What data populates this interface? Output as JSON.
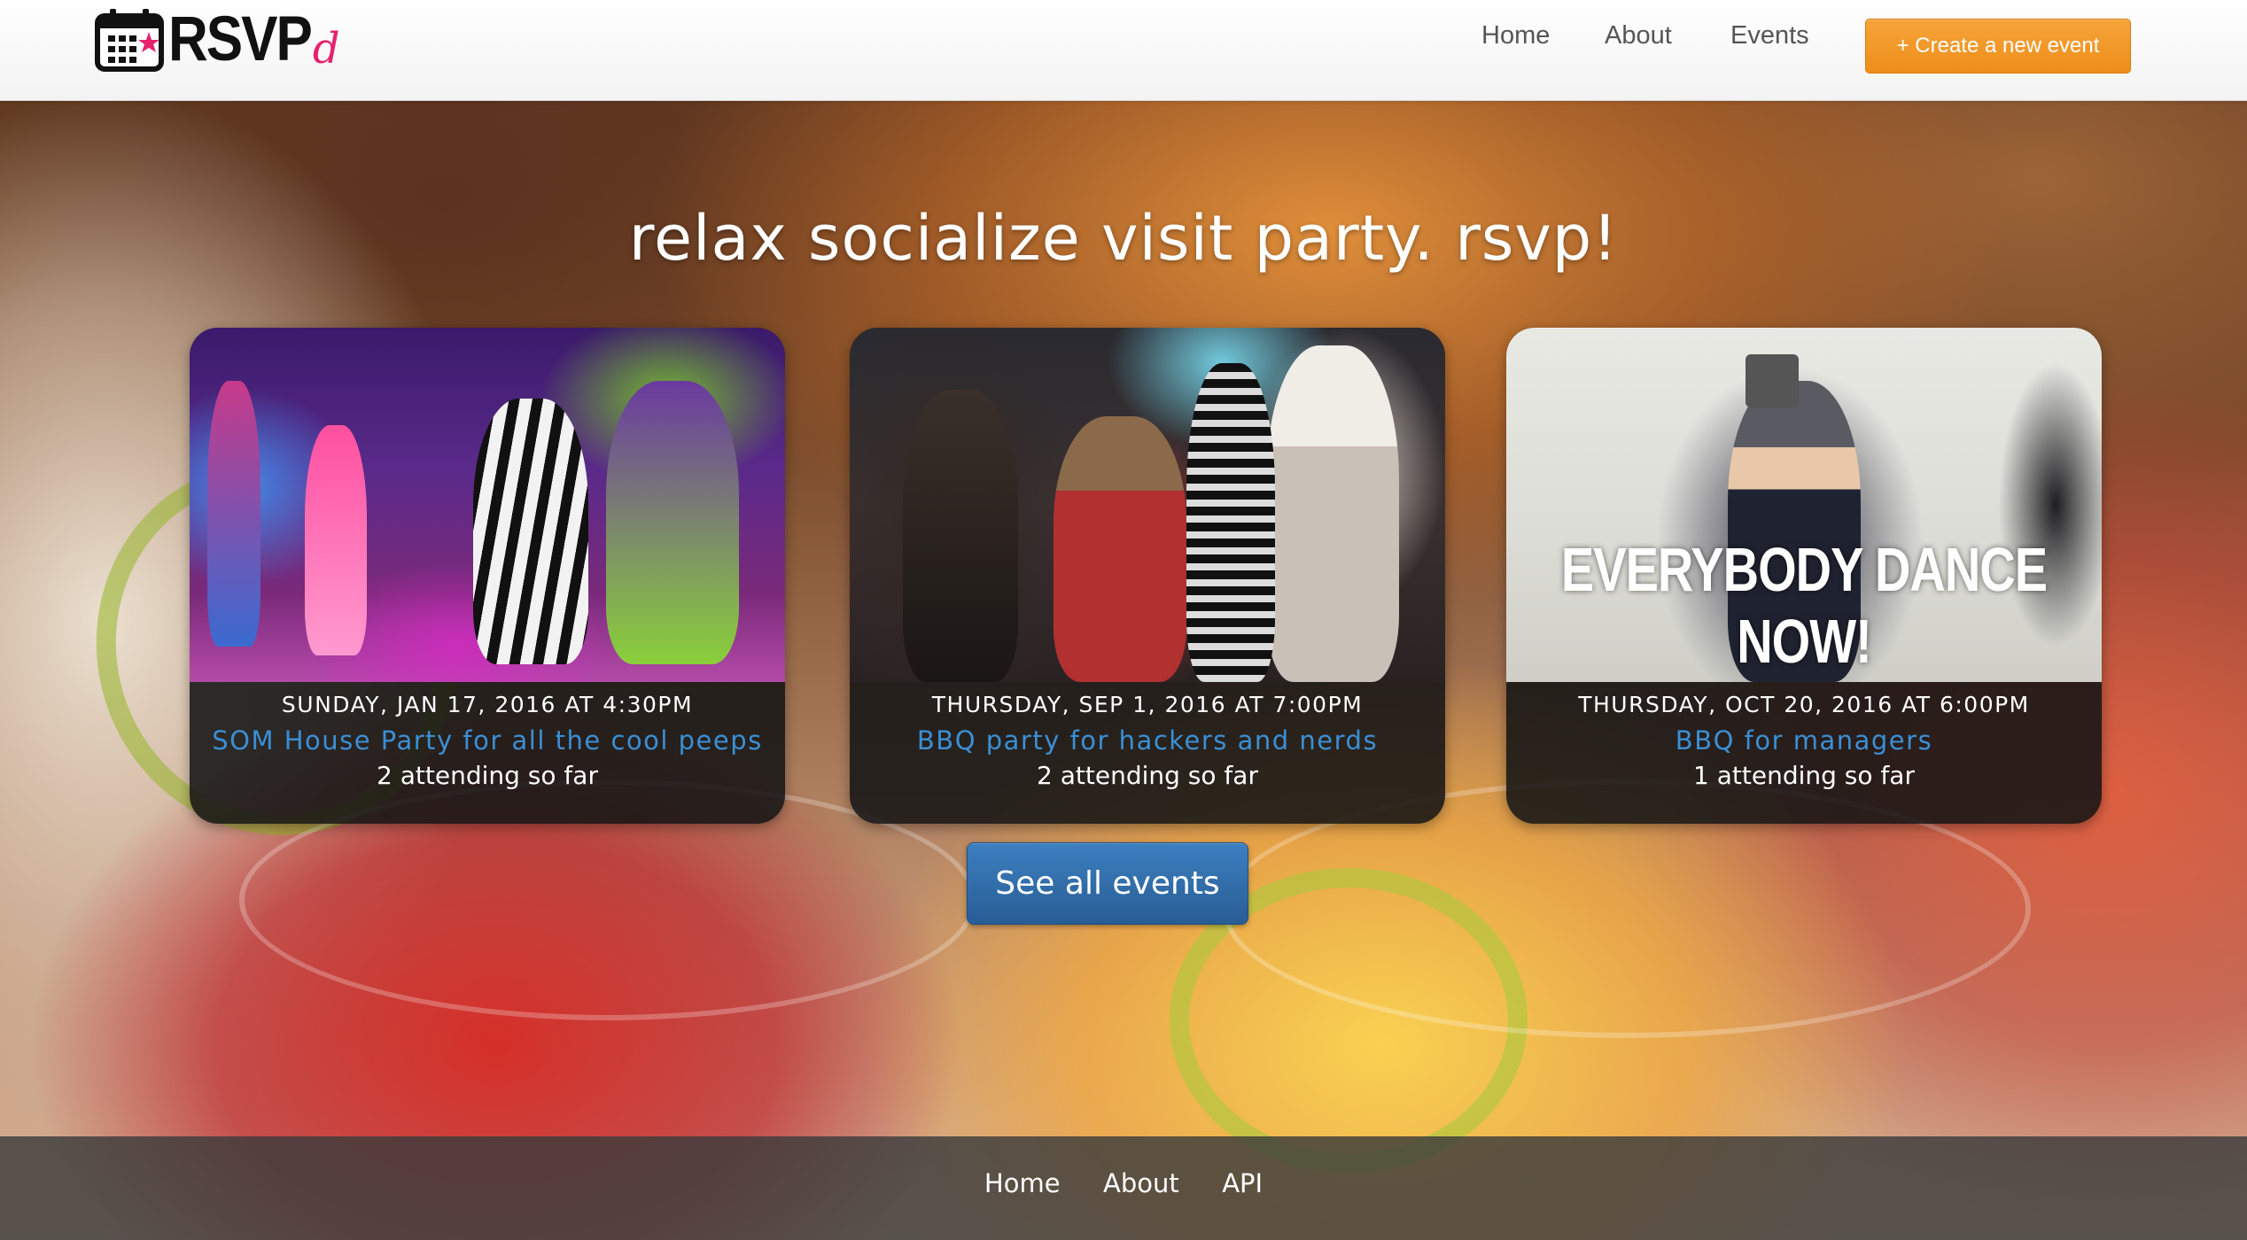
{
  "brand": {
    "name": "RSVP",
    "suffix": "d"
  },
  "nav": {
    "links": [
      "Home",
      "About",
      "Events"
    ],
    "create_button": "+ Create a new event"
  },
  "hero": {
    "title": "relax socialize visit party. rsvp!",
    "see_all_button": "See all events"
  },
  "events": [
    {
      "date": "SUNDAY, JAN 17, 2016 AT 4:30PM",
      "title": "SOM House Party for all the cool peeps",
      "attending": "2 attending so far"
    },
    {
      "date": "THURSDAY, SEP 1, 2016 AT 7:00PM",
      "title": "BBQ party for hackers and nerds",
      "attending": "2 attending so far"
    },
    {
      "date": "THURSDAY, OCT 20, 2016 AT 6:00PM",
      "title": "BBQ for managers",
      "attending": "1 attending so far",
      "image_caption": "EVERYBODY DANCE NOW!"
    }
  ],
  "footer": {
    "links": [
      "Home",
      "About",
      "API"
    ]
  },
  "colors": {
    "accent_orange": "#f39a2a",
    "link_blue": "#3a8fd6",
    "button_blue": "#2f6ea9",
    "brand_pink": "#e6216e"
  }
}
